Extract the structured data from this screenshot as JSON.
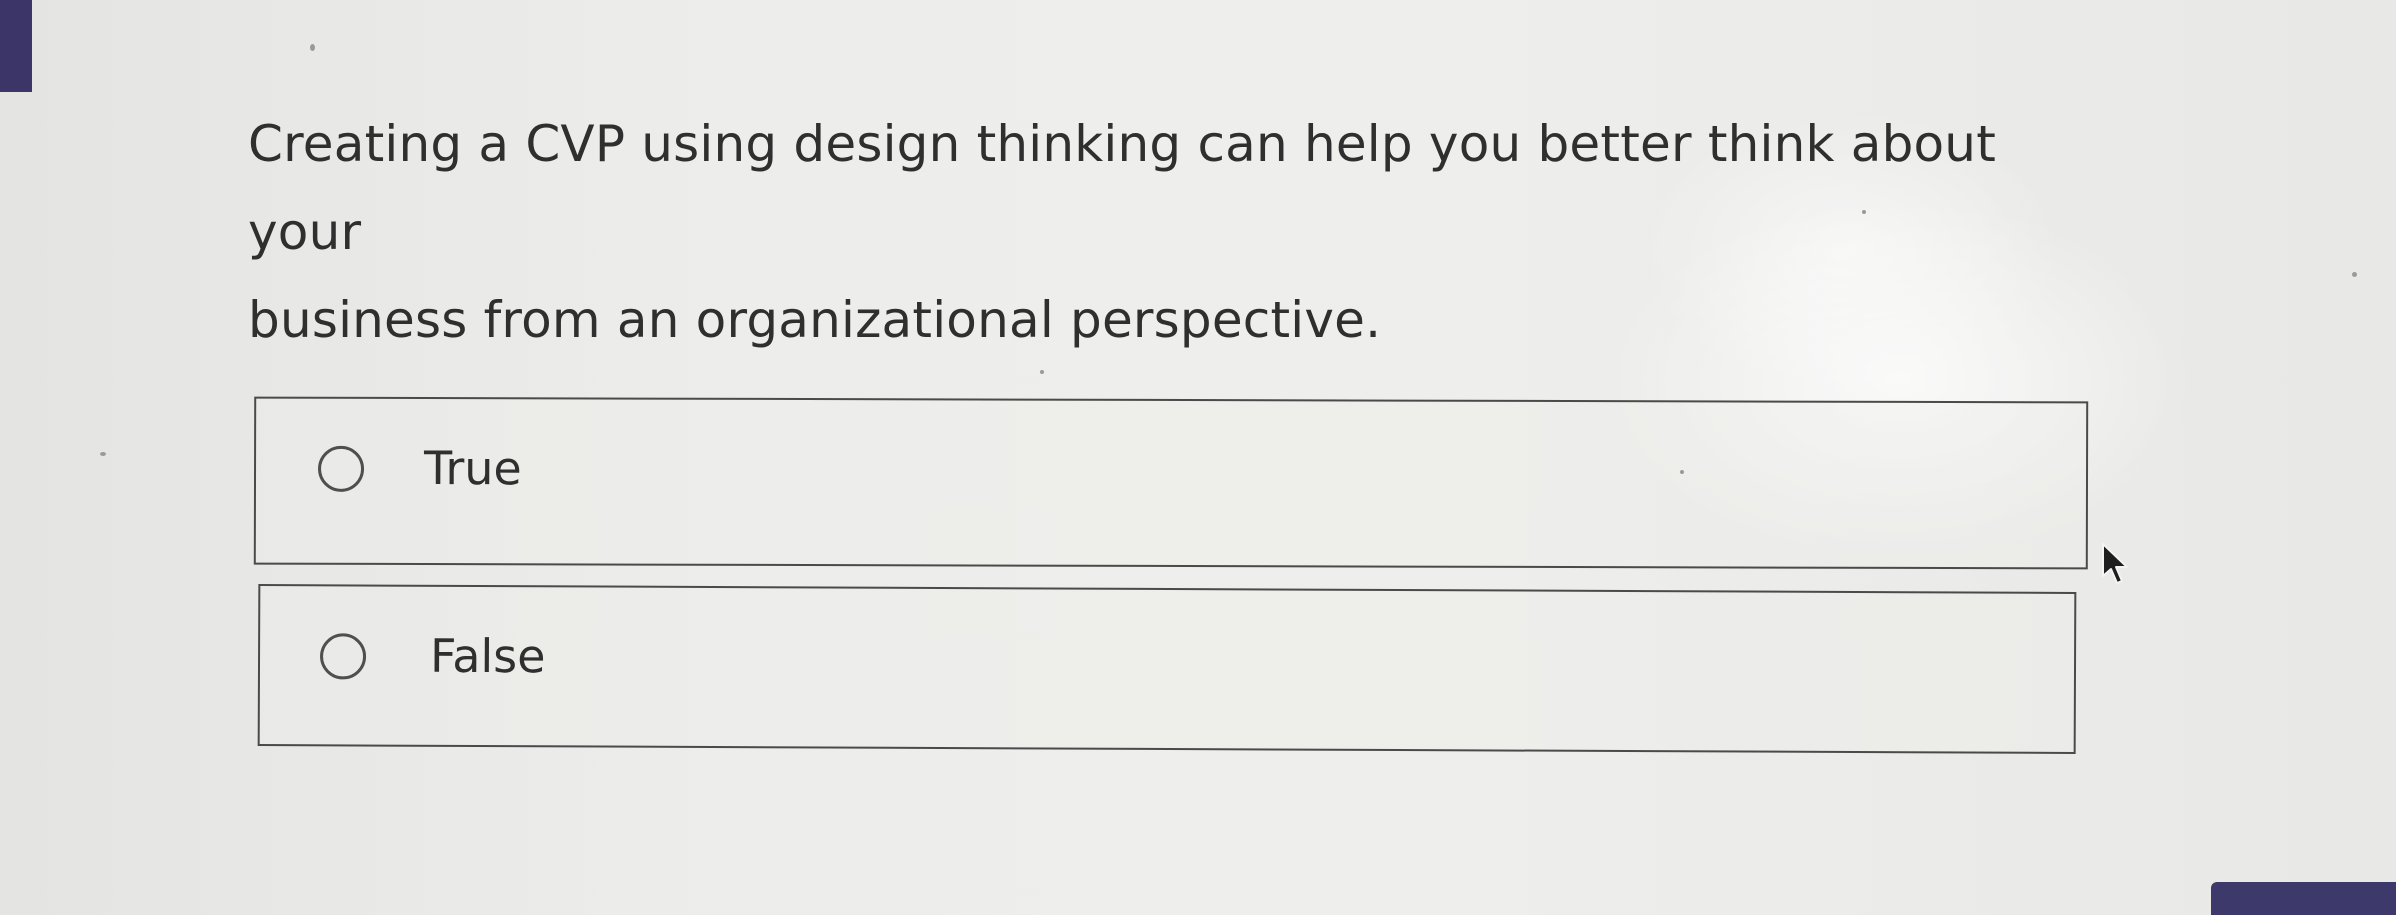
{
  "question": {
    "line1": "Creating a CVP using design thinking can help you better think about your",
    "line2": "business from an organizational perspective."
  },
  "options": [
    {
      "label": "True",
      "selected": false
    },
    {
      "label": "False",
      "selected": false
    }
  ],
  "colors": {
    "accent": "#3b3667",
    "text": "#2f2f2f",
    "border": "#4a4a4a",
    "background": "#e9e9e7"
  },
  "icons": {
    "cursor": "mouse-pointer-icon",
    "radio": "radio-circle-icon"
  }
}
